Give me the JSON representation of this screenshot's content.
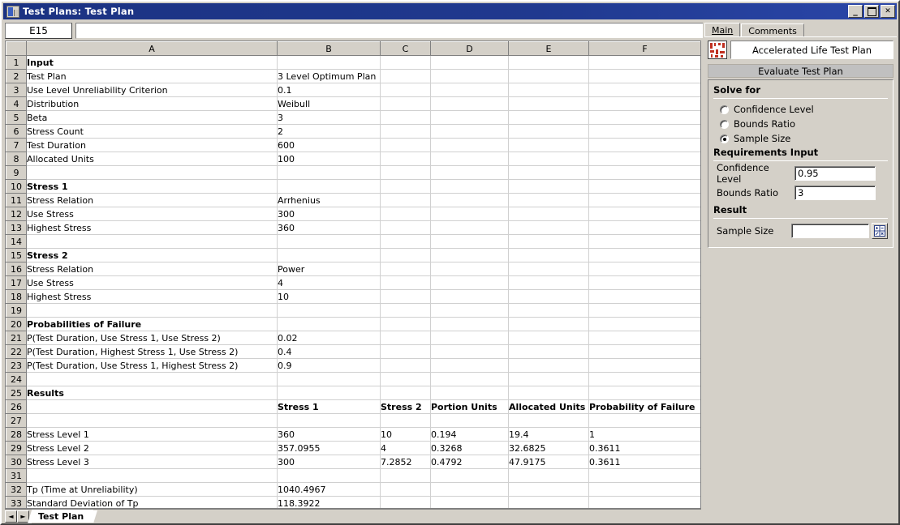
{
  "window": {
    "title": "Test Plans: Test Plan",
    "icon": "test-plan-icon",
    "buttons": {
      "minimize": "_",
      "maximize": "",
      "close": "✕"
    }
  },
  "formula_bar": {
    "name_box_value": "E15",
    "formula_value": ""
  },
  "sheet": {
    "columns": [
      "A",
      "B",
      "C",
      "D",
      "E",
      "F"
    ],
    "active_tab": "Test Plan",
    "nav_prev": "◄",
    "nav_next": "►",
    "rows": [
      {
        "n": "1",
        "cells": [
          "Input",
          "",
          "",
          "",
          "",
          ""
        ],
        "bold": true
      },
      {
        "n": "2",
        "cells": [
          "Test Plan",
          "3 Level Optimum Plan",
          "",
          "",
          "",
          ""
        ]
      },
      {
        "n": "3",
        "cells": [
          "Use Level Unreliability Criterion",
          "0.1",
          "",
          "",
          "",
          ""
        ]
      },
      {
        "n": "4",
        "cells": [
          "Distribution",
          "Weibull",
          "",
          "",
          "",
          ""
        ]
      },
      {
        "n": "5",
        "cells": [
          "Beta",
          "3",
          "",
          "",
          "",
          ""
        ]
      },
      {
        "n": "6",
        "cells": [
          "Stress Count",
          "2",
          "",
          "",
          "",
          ""
        ]
      },
      {
        "n": "7",
        "cells": [
          "Test Duration",
          "600",
          "",
          "",
          "",
          ""
        ]
      },
      {
        "n": "8",
        "cells": [
          "Allocated Units",
          "100",
          "",
          "",
          "",
          ""
        ]
      },
      {
        "n": "9",
        "cells": [
          "",
          "",
          "",
          "",
          "",
          ""
        ]
      },
      {
        "n": "10",
        "cells": [
          "Stress 1",
          "",
          "",
          "",
          "",
          ""
        ],
        "bold": true
      },
      {
        "n": "11",
        "cells": [
          "Stress Relation",
          "Arrhenius",
          "",
          "",
          "",
          ""
        ]
      },
      {
        "n": "12",
        "cells": [
          "Use Stress",
          "300",
          "",
          "",
          "",
          ""
        ]
      },
      {
        "n": "13",
        "cells": [
          "Highest Stress",
          "360",
          "",
          "",
          "",
          ""
        ]
      },
      {
        "n": "14",
        "cells": [
          "",
          "",
          "",
          "",
          "",
          ""
        ]
      },
      {
        "n": "15",
        "cells": [
          "Stress 2",
          "",
          "",
          "",
          "",
          ""
        ],
        "bold": true
      },
      {
        "n": "16",
        "cells": [
          "Stress Relation",
          "Power",
          "",
          "",
          "",
          ""
        ]
      },
      {
        "n": "17",
        "cells": [
          "Use Stress",
          "4",
          "",
          "",
          "",
          ""
        ]
      },
      {
        "n": "18",
        "cells": [
          "Highest Stress",
          "10",
          "",
          "",
          "",
          ""
        ]
      },
      {
        "n": "19",
        "cells": [
          "",
          "",
          "",
          "",
          "",
          ""
        ]
      },
      {
        "n": "20",
        "cells": [
          "Probabilities of Failure",
          "",
          "",
          "",
          "",
          ""
        ],
        "bold": true
      },
      {
        "n": "21",
        "cells": [
          "P(Test Duration, Use Stress 1, Use Stress 2)",
          "0.02",
          "",
          "",
          "",
          ""
        ]
      },
      {
        "n": "22",
        "cells": [
          "P(Test Duration, Highest Stress 1, Use Stress 2)",
          "0.4",
          "",
          "",
          "",
          ""
        ]
      },
      {
        "n": "23",
        "cells": [
          "P(Test Duration, Use Stress 1, Highest Stress 2)",
          "0.9",
          "",
          "",
          "",
          ""
        ]
      },
      {
        "n": "24",
        "cells": [
          "",
          "",
          "",
          "",
          "",
          ""
        ]
      },
      {
        "n": "25",
        "cells": [
          "Results",
          "",
          "",
          "",
          "",
          ""
        ],
        "bold": true
      },
      {
        "n": "26",
        "cells": [
          "",
          "Stress 1",
          "Stress 2",
          "Portion Units",
          "Allocated Units",
          "Probability of Failure"
        ],
        "bold": true
      },
      {
        "n": "27",
        "cells": [
          "",
          "",
          "",
          "",
          "",
          ""
        ]
      },
      {
        "n": "28",
        "cells": [
          "Stress Level 1",
          "360",
          "10",
          "0.194",
          "19.4",
          "1"
        ]
      },
      {
        "n": "29",
        "cells": [
          "Stress Level 2",
          "357.0955",
          "4",
          "0.3268",
          "32.6825",
          "0.3611"
        ]
      },
      {
        "n": "30",
        "cells": [
          "Stress Level 3",
          "300",
          "7.2852",
          "0.4792",
          "47.9175",
          "0.3611"
        ]
      },
      {
        "n": "31",
        "cells": [
          "",
          "",
          "",
          "",
          "",
          ""
        ]
      },
      {
        "n": "32",
        "cells": [
          "Tp (Time at Unreliability)",
          "1040.4967",
          "",
          "",
          "",
          ""
        ]
      },
      {
        "n": "33",
        "cells": [
          "Standard Deviation of Tp",
          "118.3922",
          "",
          "",
          "",
          ""
        ]
      }
    ]
  },
  "panel": {
    "tabs": [
      {
        "label": "Main",
        "active": true
      },
      {
        "label": "Comments",
        "active": false
      }
    ],
    "plan_icon": "test-plan-thumbnail-icon",
    "plan_title": "Accelerated Life Test Plan",
    "section_header": "Evaluate Test Plan",
    "solve_for_label": "Solve for",
    "solve_for_options": [
      {
        "label": "Confidence Level",
        "selected": false
      },
      {
        "label": "Bounds Ratio",
        "selected": false
      },
      {
        "label": "Sample Size",
        "selected": true
      }
    ],
    "requirements_label": "Requirements Input",
    "requirements": [
      {
        "label": "Confidence Level",
        "value": "0.95"
      },
      {
        "label": "Bounds Ratio",
        "value": "3"
      }
    ],
    "result_label": "Result",
    "result": {
      "label": "Sample Size",
      "value": ""
    },
    "calculate_button": "calculator-icon"
  },
  "colors": {
    "titlebar": "#1b3282",
    "chrome": "#d4d0c8",
    "header_band": "#c0c0c0",
    "grid_line": "#d0d0d0"
  }
}
